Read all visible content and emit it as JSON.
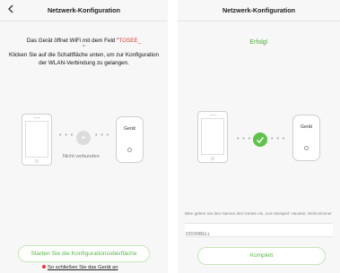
{
  "left_screen": {
    "title": "Netzwerk-Konfiguration",
    "back_icon": "chevron-left-icon",
    "instruction_prefix": "Das Gerät öffnet WiFi mit dem Feld \"",
    "ssid": "TOSEE_",
    "instruction_mid": "\"",
    "instruction_rest": "Klicken Sie auf die Schaltfläche unten, um zur Konfiguration der WLAN-Verbindung zu gelangen.",
    "device_label": "Gerät",
    "connection_status": "Nicht verbunden",
    "config_button": "Starten Sie die Konfigurationsoberfläche",
    "close_link": "So schließen Sie das Gerät an"
  },
  "right_screen": {
    "title": "Netzwerk-Konfiguration",
    "success_text": "Erfolg!",
    "device_label": "Gerät",
    "hint_text": "Bitte geben Sie den Namen des Geräts ein, zum Beispiel: Haustür, Wohnzimmer",
    "name_input_value": "",
    "name_input_placeholder": "DOORBELL",
    "complete_button": "Komplett"
  },
  "colors": {
    "accent_green": "#5fc24a",
    "warning_red": "#e63838"
  }
}
